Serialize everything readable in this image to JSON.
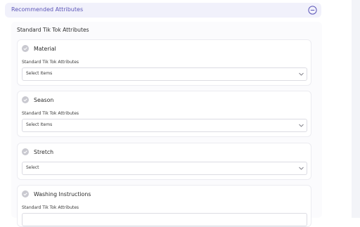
{
  "section": {
    "title": "Recommended Attributes"
  },
  "panel": {
    "title": "Standard Tik Tok Attributes"
  },
  "attributes": [
    {
      "label": "Material",
      "sublabel": "Standard Tik Tok Attributes",
      "select": "Select Items"
    },
    {
      "label": "Season",
      "sublabel": "Standard Tik Tok Attributes",
      "select": "Select Items"
    },
    {
      "label": "Stretch",
      "select": "Select"
    },
    {
      "label": "Washing Instructions",
      "sublabel": "Standard Tik Tok Attributes"
    }
  ],
  "colors": {
    "accent": "#5c56b8",
    "header_bg": "#f1f1fb",
    "check": "#c9c9d0"
  }
}
